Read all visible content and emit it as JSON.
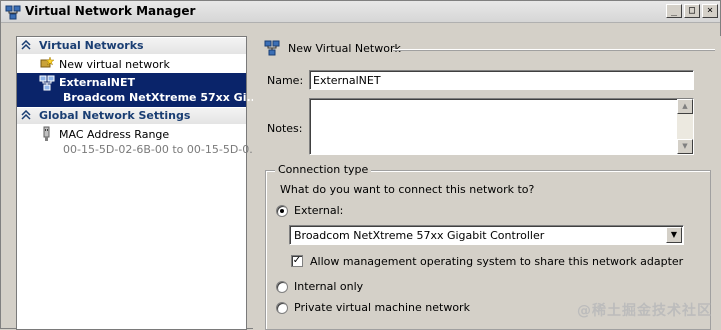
{
  "window": {
    "title": "Virtual Network Manager",
    "controls": {
      "minimize": "_",
      "maximize": "□",
      "close": "×"
    }
  },
  "sidebar": {
    "sections": [
      {
        "label": "Virtual Networks",
        "items": [
          {
            "label": "New virtual network",
            "icon": "new-network-icon"
          },
          {
            "label": "ExternalNET",
            "sublabel": "Broadcom NetXtreme 57xx Gi...",
            "icon": "network-icon",
            "selected": true
          }
        ]
      },
      {
        "label": "Global Network Settings",
        "items": [
          {
            "label": "MAC Address Range",
            "sublabel": "00-15-5D-02-6B-00 to 00-15-5D-0...",
            "icon": "mac-range-icon"
          }
        ]
      }
    ]
  },
  "main": {
    "header": "New Virtual Network",
    "name_label": "Name:",
    "name_value": "ExternalNET",
    "notes_label": "Notes:",
    "notes_value": "",
    "connection": {
      "legend": "Connection type",
      "question": "What do you want to connect this network to?",
      "options": [
        {
          "label": "External:",
          "checked": true
        },
        {
          "label": "Internal only",
          "checked": false
        },
        {
          "label": "Private virtual machine network",
          "checked": false
        }
      ],
      "adapter_value": "Broadcom NetXtreme 57xx Gigabit Controller",
      "allow_management_label": "Allow management operating system to share this network adapter",
      "allow_management_checked": true
    }
  },
  "watermark": "@稀土掘金技术社区",
  "colors": {
    "selection": "#0a246a",
    "section_header_text": "#1a3e73",
    "dialog_bg": "#d4d0c8"
  }
}
